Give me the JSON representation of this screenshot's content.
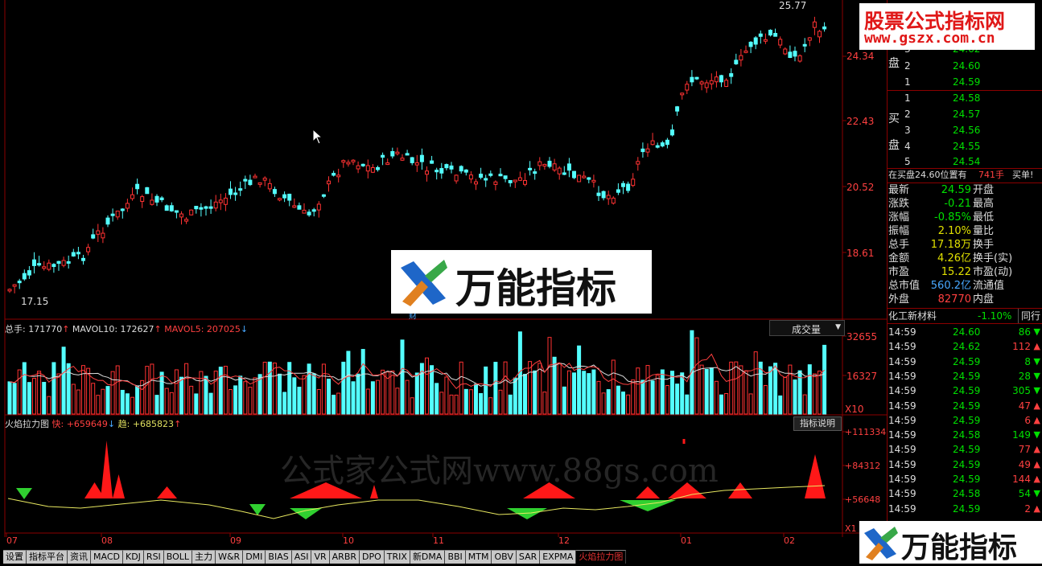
{
  "main_chart": {
    "price_axis_labels": [
      "24.34",
      "22.43",
      "20.52",
      "18.61"
    ],
    "high_marker": "25.77",
    "low_marker": "17.15",
    "dot_label": "财"
  },
  "volume_panel": {
    "label_total": "总手: 171770",
    "label_ma10": "MAVOL10: 172627",
    "label_ma5": "MAVOL5: 207025",
    "selector_label": "成交量",
    "axis_labels": [
      "32655",
      "16327"
    ],
    "multiplier": "X10"
  },
  "indicator_panel": {
    "name": "火焰拉力图",
    "fast_label": "快: +659649",
    "trend_label": "趋: +685823",
    "help_button": "指标说明",
    "axis_labels": [
      "+111334",
      "+84312",
      "+56648"
    ],
    "multiplier": "X1",
    "watermark": "公式家公式网www.88gs.com"
  },
  "x_axis_months": [
    "07",
    "08",
    "09",
    "10",
    "11",
    "12",
    "01",
    "02"
  ],
  "tabs": [
    "设置",
    "指标平台",
    "资讯",
    "MACD",
    "KDJ",
    "RSI",
    "BOLL",
    "主力",
    "W&R",
    "DMI",
    "BIAS",
    "ASI",
    "VR",
    "ARBR",
    "DPO",
    "TRIX",
    "新DMA",
    "BBI",
    "MTM",
    "OBV",
    "SAR",
    "EXPMA",
    "火焰拉力图"
  ],
  "watermarks": {
    "top_right_title": "股票公式指标网",
    "top_right_url": "www.gszx.com.cn",
    "center_logo": "万能指标",
    "bottom_logo": "万能指标"
  },
  "order_book": {
    "sell_label": [
      "盘"
    ],
    "sell": [
      {
        "level": "3",
        "price": "24.62"
      },
      {
        "level": "2",
        "price": "24.60"
      },
      {
        "level": "1",
        "price": "24.59"
      }
    ],
    "buy_label": [
      "买",
      "盘"
    ],
    "buy": [
      {
        "level": "1",
        "price": "24.58"
      },
      {
        "level": "2",
        "price": "24.57"
      },
      {
        "level": "3",
        "price": "24.56"
      },
      {
        "level": "4",
        "price": "24.55"
      },
      {
        "level": "5",
        "price": "24.54"
      }
    ],
    "status_line": "在买盘24.60位置有",
    "status_qty": "741手",
    "status_tail": "买单!"
  },
  "quote": [
    {
      "label": "最新",
      "value": "24.59",
      "label2": "开盘",
      "color": "#00e000"
    },
    {
      "label": "涨跌",
      "value": "-0.21",
      "label2": "最高",
      "color": "#00e000"
    },
    {
      "label": "涨幅",
      "value": "-0.85%",
      "label2": "最低",
      "color": "#00e000"
    },
    {
      "label": "振幅",
      "value": "2.10%",
      "label2": "量比",
      "color": "#e0e000"
    },
    {
      "label": "总手",
      "value": "17.18万",
      "label2": "换手",
      "color": "#e0e000"
    },
    {
      "label": "金额",
      "value": "4.26亿",
      "label2": "换手(实)",
      "color": "#e0e000"
    },
    {
      "label": "市盈",
      "value": "15.22",
      "label2": "市盈(动)",
      "color": "#e0e000"
    },
    {
      "label": "总市值",
      "value": "560.2亿",
      "label2": "流通值",
      "color": "#48a8ff"
    },
    {
      "label": "外盘",
      "value": "82770",
      "label2": "内盘",
      "color": "#ff4040"
    }
  ],
  "sector": {
    "name": "化工新材料",
    "change": "-1.10%",
    "button": "同行"
  },
  "ticks": [
    {
      "time": "14:59",
      "price": "24.60",
      "vol": "86",
      "dir": "down"
    },
    {
      "time": "14:59",
      "price": "24.62",
      "vol": "112",
      "dir": "up"
    },
    {
      "time": "14:59",
      "price": "24.59",
      "vol": "8",
      "dir": "down"
    },
    {
      "time": "14:59",
      "price": "24.59",
      "vol": "28",
      "dir": "down"
    },
    {
      "time": "14:59",
      "price": "24.59",
      "vol": "305",
      "dir": "down"
    },
    {
      "time": "14:59",
      "price": "24.59",
      "vol": "47",
      "dir": "up"
    },
    {
      "time": "14:59",
      "price": "24.59",
      "vol": "6",
      "dir": "up"
    },
    {
      "time": "14:59",
      "price": "24.58",
      "vol": "149",
      "dir": "down"
    },
    {
      "time": "14:59",
      "price": "24.59",
      "vol": "77",
      "dir": "up"
    },
    {
      "time": "14:59",
      "price": "24.59",
      "vol": "49",
      "dir": "up"
    },
    {
      "time": "14:59",
      "price": "24.59",
      "vol": "144",
      "dir": "up"
    },
    {
      "time": "14:59",
      "price": "24.58",
      "vol": "54",
      "dir": "down"
    },
    {
      "time": "14:59",
      "price": "24.59",
      "vol": "2",
      "dir": "up"
    }
  ],
  "colors": {
    "up": "#ff3232",
    "down": "#54ffff",
    "frame": "#8b0000",
    "green": "#00e000"
  }
}
